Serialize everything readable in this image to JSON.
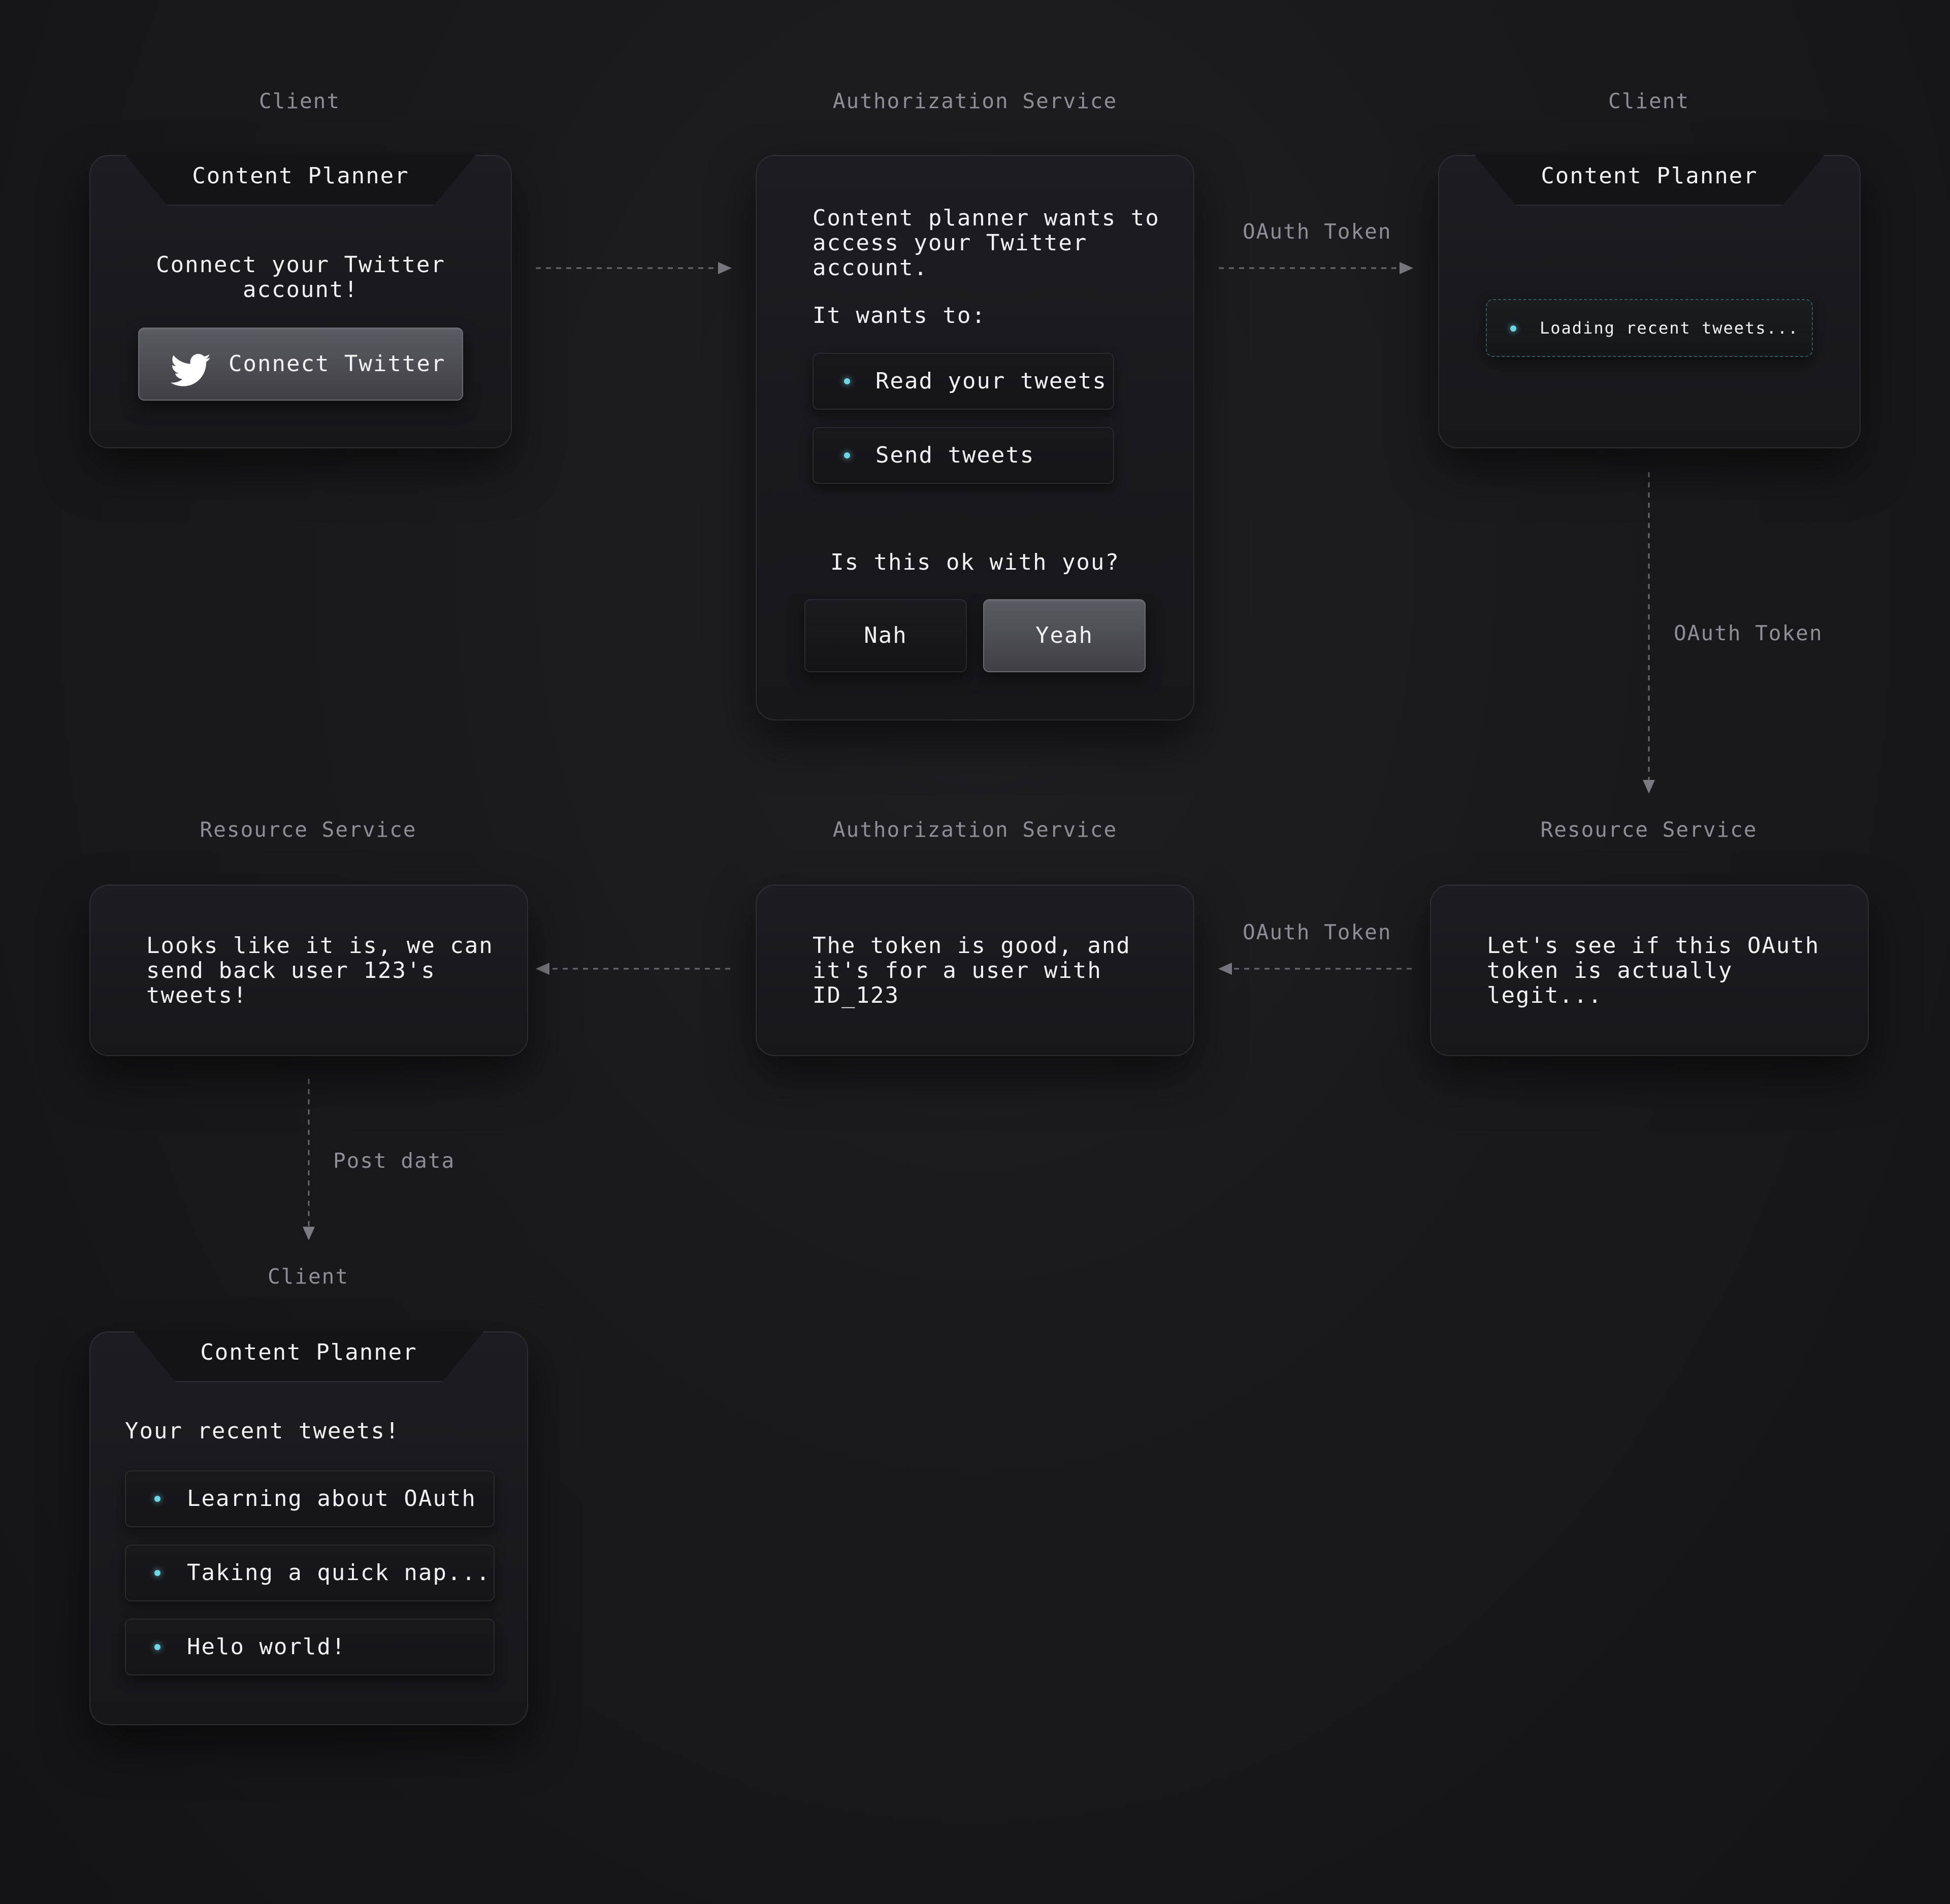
{
  "diagram": {
    "columns": {
      "client_1": "Client",
      "auth_1": "Authorization Service",
      "client_2": "Client",
      "resource_1": "Resource Service",
      "auth_2": "Authorization Service",
      "resource_2": "Resource Service",
      "client_3": "Client"
    },
    "arrows": {
      "oauth_token_1": "OAuth Token",
      "oauth_token_2": "OAuth Token",
      "oauth_token_3": "OAuth Token",
      "post_data": "Post data"
    },
    "card_connect": {
      "tab": "Content Planner",
      "message": "Connect your Twitter\naccount!",
      "button_label": "Connect Twitter",
      "button_icon": "twitter-bird-icon"
    },
    "card_consent": {
      "message": "Content planner wants to\naccess your Twitter\naccount.",
      "intro": "It wants to:",
      "permissions": [
        "Read your tweets",
        "Send tweets"
      ],
      "question": "Is this ok with you?",
      "deny_label": "Nah",
      "approve_label": "Yeah"
    },
    "card_loading": {
      "tab": "Content Planner",
      "status": "Loading recent tweets..."
    },
    "card_resource_check": {
      "message": "Let's see if this OAuth\ntoken is actually\nlegit..."
    },
    "card_token_valid": {
      "message": "The token is good, and\nit's for a user with\nID_123"
    },
    "card_send_back": {
      "message": "Looks like it is, we can\nsend back user 123's\ntweets!"
    },
    "card_tweets": {
      "tab": "Content Planner",
      "heading": "Your recent tweets!",
      "tweets": [
        "Learning about OAuth",
        "Taking a quick nap...",
        "Helo world!"
      ]
    },
    "colors": {
      "background": "#18181a",
      "card": "#1b1b1e",
      "accent_dot": "#6fd6e6",
      "label": "#8e8e95",
      "text": "#f2f2f4"
    }
  }
}
